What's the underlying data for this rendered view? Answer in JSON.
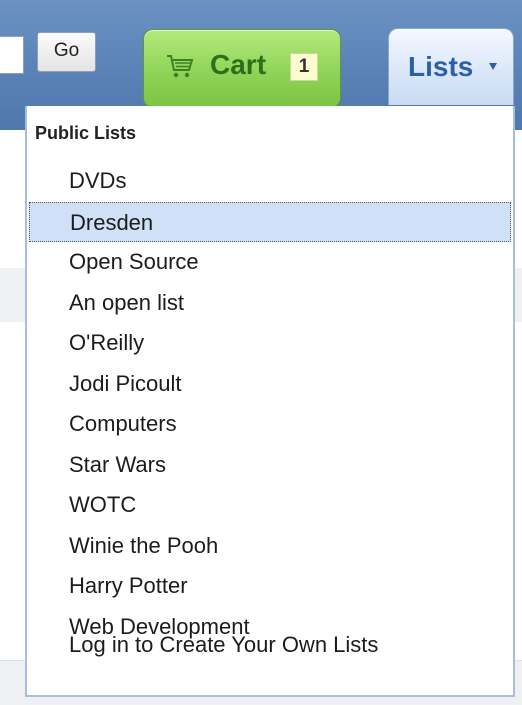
{
  "search": {
    "go_label": "Go"
  },
  "cart": {
    "label": "Cart",
    "count": "1",
    "icon": "shopping-cart-icon"
  },
  "lists_button": {
    "label": "Lists",
    "icon": "caret-down-icon"
  },
  "dropdown": {
    "heading": "Public Lists",
    "items": [
      {
        "label": "DVDs"
      },
      {
        "label": "Dresden",
        "highlighted": true
      },
      {
        "label": "Open Source"
      },
      {
        "label": "An open list"
      },
      {
        "label": "O'Reilly"
      },
      {
        "label": "Jodi Picoult"
      },
      {
        "label": "Computers"
      },
      {
        "label": "Star Wars"
      },
      {
        "label": "WOTC"
      },
      {
        "label": "Winie the Pooh"
      },
      {
        "label": "Harry Potter"
      },
      {
        "label": "Web Development"
      }
    ],
    "login_label": "Log in to Create Your Own Lists"
  },
  "colors": {
    "header": "#5a82b6",
    "cart_green": "#8fd457",
    "cart_text": "#2f6e1a",
    "lists_text": "#2d5fa6",
    "highlight": "#cfe0f7"
  }
}
